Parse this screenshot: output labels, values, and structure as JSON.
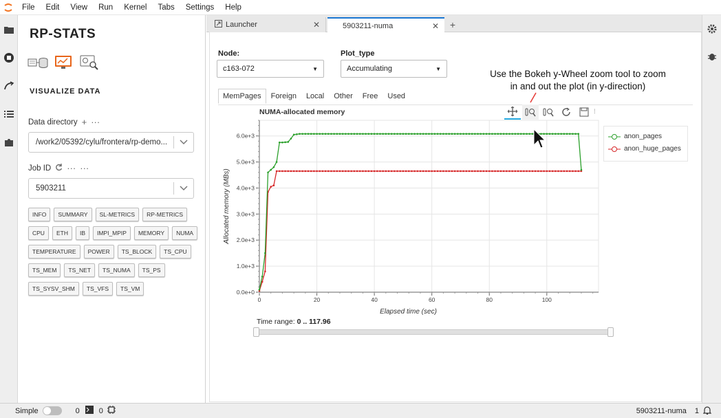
{
  "menu": [
    "File",
    "Edit",
    "View",
    "Run",
    "Kernel",
    "Tabs",
    "Settings",
    "Help"
  ],
  "sidebar": {
    "title": "RP-STATS",
    "section": "VISUALIZE DATA",
    "data_directory_label": "Data directory",
    "data_directory_value": "/work2/05392/cylu/frontera/rp-demo...",
    "job_id_label": "Job ID",
    "job_id_value": "5903211",
    "buttons_rows": [
      [
        "INFO",
        "SUMMARY",
        "SL-METRICS",
        "RP-METRICS"
      ],
      [
        "CPU",
        "ETH",
        "IB",
        "IMPI_MPIP",
        "MEMORY",
        "NUMA"
      ],
      [
        "TEMPERATURE",
        "POWER",
        "TS_BLOCK",
        "TS_CPU"
      ],
      [
        "TS_MEM",
        "TS_NET",
        "TS_NUMA",
        "TS_PS"
      ],
      [
        "TS_SYSV_SHM",
        "TS_VFS",
        "TS_VM"
      ]
    ]
  },
  "tabs": {
    "launcher": "Launcher",
    "active": "5903211-numa"
  },
  "controls": {
    "node_label": "Node:",
    "node_value": "c163-072",
    "plot_type_label": "Plot_type",
    "plot_type_value": "Accumulating"
  },
  "plot_tabs": [
    "MemPages",
    "Foreign",
    "Local",
    "Other",
    "Free",
    "Used"
  ],
  "annotation": "Use the Bokeh y-Wheel zoom tool to zoom in and out the plot (in y-direction)",
  "chart_data": {
    "type": "line",
    "title": "NUMA-allocated memory",
    "xlabel": "Elapsed time (sec)",
    "ylabel": "Allocated memory (MBs)",
    "xlim": [
      0,
      118
    ],
    "ylim": [
      0,
      6600
    ],
    "x_ticks": [
      0,
      20,
      40,
      60,
      80,
      100
    ],
    "y_ticks": [
      {
        "v": 0,
        "label": "0.0e+0"
      },
      {
        "v": 1000,
        "label": "1.0e+3"
      },
      {
        "v": 2000,
        "label": "2.0e+3"
      },
      {
        "v": 3000,
        "label": "3.0e+3"
      },
      {
        "v": 4000,
        "label": "4.0e+3"
      },
      {
        "v": 5000,
        "label": "5.0e+3"
      },
      {
        "v": 6000,
        "label": "6.0e+3"
      }
    ],
    "legend_position": "right",
    "series": [
      {
        "name": "anon_pages",
        "color": "#2ca02c",
        "x": [
          0,
          1,
          2,
          3,
          4,
          5,
          6,
          7,
          8,
          9,
          10,
          11,
          12,
          14,
          20,
          40,
          60,
          80,
          100,
          111,
          112
        ],
        "y": [
          100,
          600,
          1500,
          4600,
          4700,
          4800,
          5000,
          5750,
          5750,
          5760,
          5770,
          5900,
          6050,
          6080,
          6080,
          6080,
          6080,
          6080,
          6080,
          6080,
          4700
        ]
      },
      {
        "name": "anon_huge_pages",
        "color": "#d62728",
        "x": [
          0,
          1,
          2,
          3,
          4,
          5,
          6,
          7,
          20,
          40,
          60,
          80,
          100,
          112
        ],
        "y": [
          50,
          400,
          800,
          3850,
          4050,
          4100,
          4650,
          4650,
          4650,
          4650,
          4650,
          4650,
          4650,
          4650
        ]
      }
    ]
  },
  "time_range": {
    "label": "Time range:",
    "value": "0 .. 117.96"
  },
  "status": {
    "simple_label": "Simple",
    "terminals_count": "0",
    "kernels_count": "0",
    "right_label": "5903211-numa",
    "notifications": "1"
  }
}
